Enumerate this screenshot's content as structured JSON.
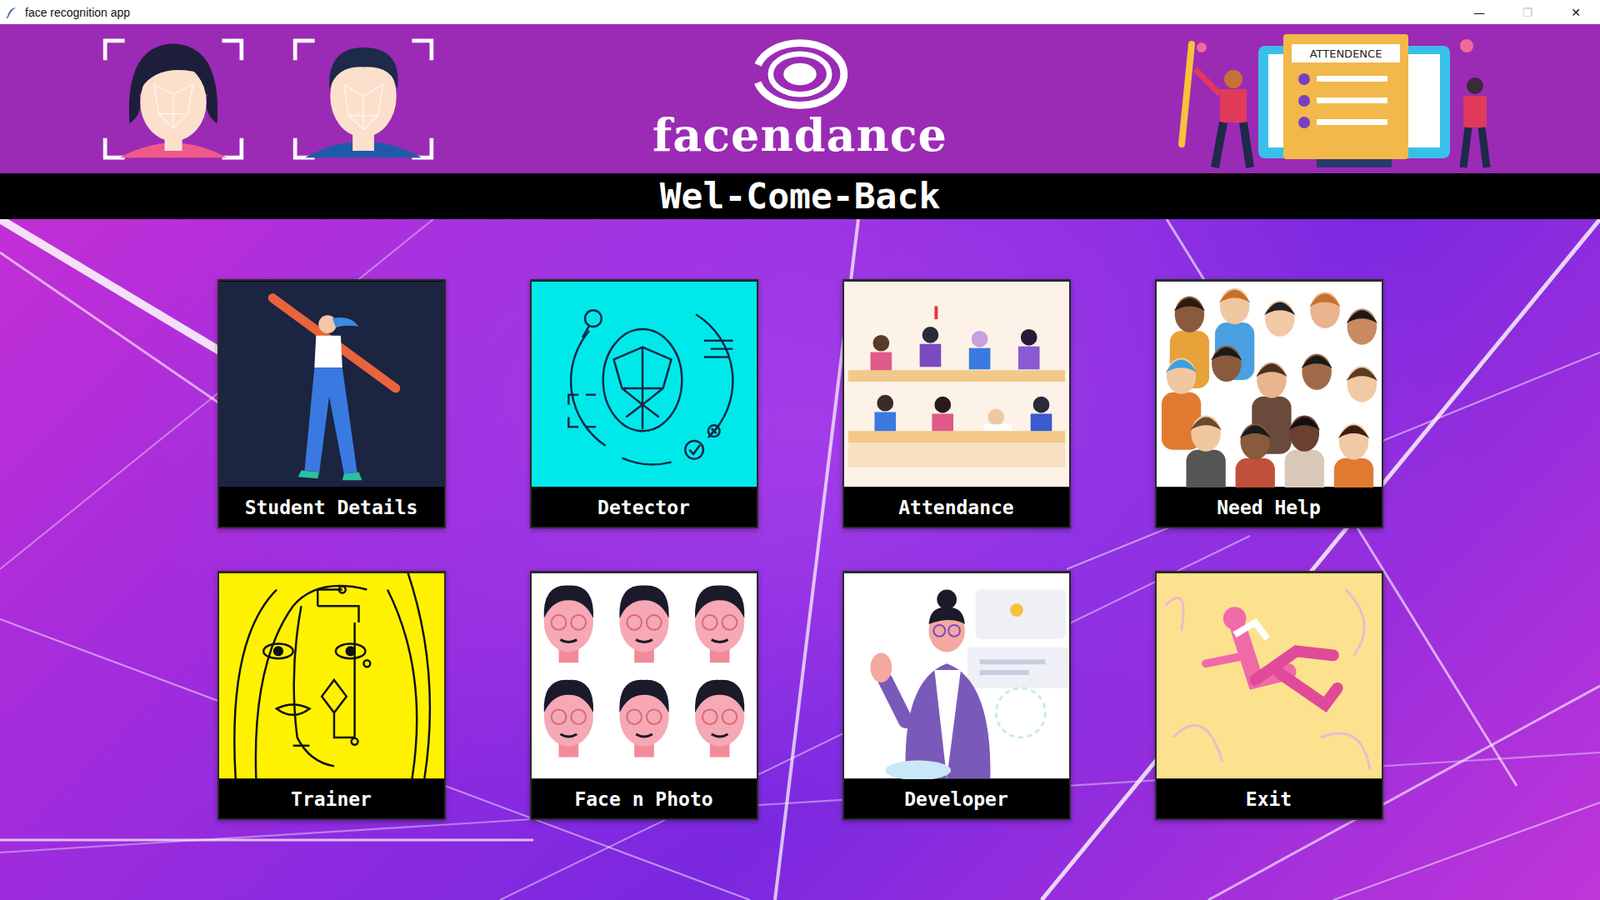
{
  "window": {
    "title": "face recognition app",
    "controls": [
      {
        "glyph": "—",
        "disabled": false
      },
      {
        "glyph": "❐",
        "disabled": true
      },
      {
        "glyph": "✕",
        "disabled": false
      }
    ]
  },
  "header": {
    "logo": "facendance",
    "banner_text": "ATTENDENCE"
  },
  "welcome": "Wel-Come-Back",
  "tiles": [
    {
      "label": "Student Details"
    },
    {
      "label": "Detector"
    },
    {
      "label": "Attendance"
    },
    {
      "label": "Need Help"
    },
    {
      "label": "Trainer"
    },
    {
      "label": "Face n Photo"
    },
    {
      "label": "Developer"
    },
    {
      "label": "Exit"
    }
  ]
}
